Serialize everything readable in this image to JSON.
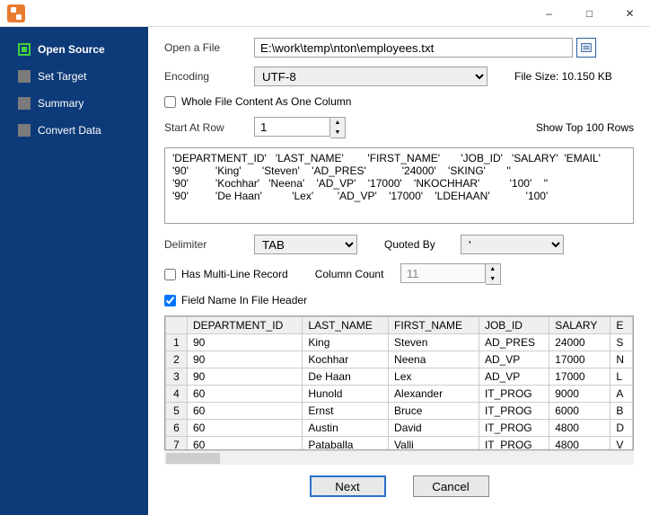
{
  "titlebar": {
    "minimize": "–",
    "maximize": "□",
    "close": "✕"
  },
  "sidebar": {
    "items": [
      {
        "label": "Open Source",
        "active": true
      },
      {
        "label": "Set Target",
        "active": false
      },
      {
        "label": "Summary",
        "active": false
      },
      {
        "label": "Convert Data",
        "active": false
      }
    ]
  },
  "form": {
    "open_file_label": "Open a File",
    "open_file_value": "E:\\work\\temp\\nton\\employees.txt",
    "encoding_label": "Encoding",
    "encoding_value": "UTF-8",
    "file_size_label": "File Size: 10.150 KB",
    "whole_file_label": "Whole File Content As One Column",
    "whole_file_checked": false,
    "start_row_label": "Start At Row",
    "start_row_value": "1",
    "show_top_label": "Show Top 100 Rows",
    "delimiter_label": "Delimiter",
    "delimiter_value": "TAB",
    "quoted_by_label": "Quoted By",
    "quoted_by_value": "'",
    "multiline_label": "Has Multi-Line Record",
    "multiline_checked": false,
    "column_count_label": "Column Count",
    "column_count_value": "11",
    "fieldname_header_label": "Field Name In File Header",
    "fieldname_header_checked": true
  },
  "preview_lines": [
    "'DEPARTMENT_ID'   'LAST_NAME'        'FIRST_NAME'       'JOB_ID'   'SALARY'  'EMAIL'",
    "'90'         'King'       'Steven'    'AD_PRES'            '24000'    'SKING'       ''",
    "'90'         'Kochhar'   'Neena'    'AD_VP'    '17000'    'NKOCHHAR'          '100'    ''",
    "'90'         'De Haan'          'Lex'        'AD_VP'    '17000'    'LDEHAAN'            '100'"
  ],
  "table": {
    "columns": [
      "DEPARTMENT_ID",
      "LAST_NAME",
      "FIRST_NAME",
      "JOB_ID",
      "SALARY",
      "E"
    ],
    "rows": [
      [
        "90",
        "King",
        "Steven",
        "AD_PRES",
        "24000",
        "S"
      ],
      [
        "90",
        "Kochhar",
        "Neena",
        "AD_VP",
        "17000",
        "N"
      ],
      [
        "90",
        "De Haan",
        "Lex",
        "AD_VP",
        "17000",
        "L"
      ],
      [
        "60",
        "Hunold",
        "Alexander",
        "IT_PROG",
        "9000",
        "A"
      ],
      [
        "60",
        "Ernst",
        "Bruce",
        "IT_PROG",
        "6000",
        "B"
      ],
      [
        "60",
        "Austin",
        "David",
        "IT_PROG",
        "4800",
        "D"
      ],
      [
        "60",
        "Pataballa",
        "Valli",
        "IT_PROG",
        "4800",
        "V"
      ]
    ]
  },
  "buttons": {
    "next": "Next",
    "cancel": "Cancel"
  }
}
